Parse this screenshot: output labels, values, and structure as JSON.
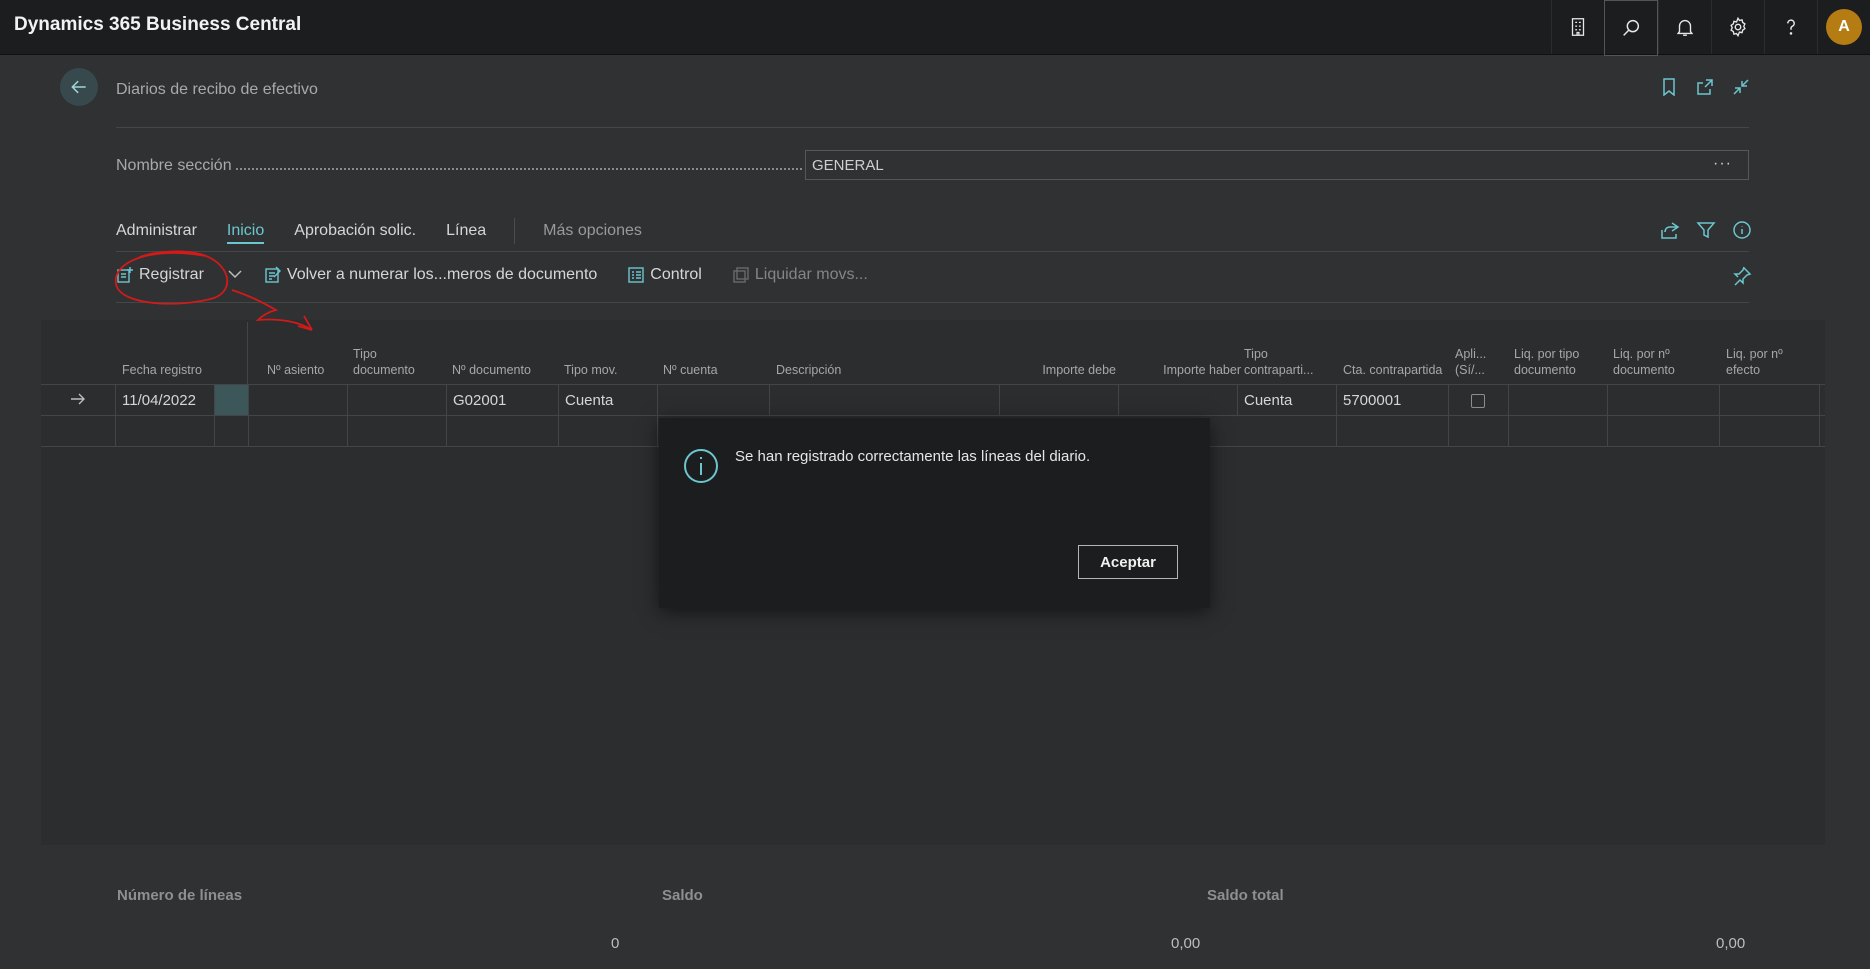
{
  "app": {
    "title": "Dynamics 365 Business Central",
    "avatar_initial": "A"
  },
  "topbar_icons": [
    "building-icon",
    "search-icon",
    "bell-icon",
    "gear-icon",
    "help-icon",
    "avatar"
  ],
  "page": {
    "title": "Diarios de recibo de efectivo"
  },
  "batch": {
    "label": "Nombre sección",
    "value": "GENERAL",
    "more": "···"
  },
  "tabs": [
    {
      "label": "Administrar",
      "active": false
    },
    {
      "label": "Inicio",
      "active": true
    },
    {
      "label": "Aprobación solic.",
      "active": false
    },
    {
      "label": "Línea",
      "active": false
    },
    {
      "label": "Más opciones",
      "active": false
    }
  ],
  "actions": {
    "post": "Registrar",
    "renumber": "Volver a numerar los...meros de documento",
    "control": "Control",
    "apply": "Liquidar movs..."
  },
  "columns": [
    "Fecha registro",
    "Nº asiento",
    "Tipo documento",
    "Nº documento",
    "Tipo mov.",
    "Nº cuenta",
    "Descripción",
    "Importe debe",
    "Importe haber",
    "Tipo contraparti...",
    "Cta. contrapartida",
    "Apli... (Sí/...",
    "Liq. por tipo documento",
    "Liq. por nº documento",
    "Liq. por nº efecto"
  ],
  "rows": [
    {
      "fecha": "11/04/2022",
      "asiento": "",
      "tipo_doc": "",
      "documento": "G02001",
      "tipo_mov": "Cuenta",
      "cuenta": "",
      "descripcion": "",
      "debe": "",
      "haber": "",
      "tipo_contra": "Cuenta",
      "cta_contra": "5700001",
      "aplicado": false
    }
  ],
  "footer": {
    "lines_label": "Número de líneas",
    "lines_value": "0",
    "balance_label": "Saldo",
    "balance_value": "0,00",
    "total_label": "Saldo total",
    "total_value": "0,00"
  },
  "dialog": {
    "message": "Se han registrado correctamente las líneas del diario.",
    "ok_label": "Aceptar"
  },
  "colors": {
    "accent": "#6cc6cf",
    "annotation": "#d11a1a",
    "avatar": "#b57c14"
  }
}
